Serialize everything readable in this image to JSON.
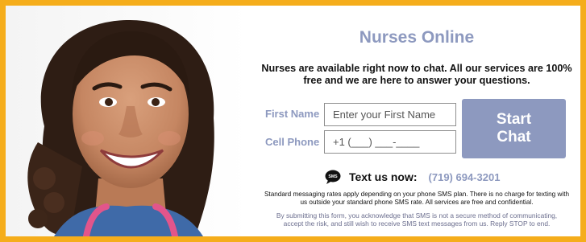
{
  "banner": {
    "title": "Nurses Online",
    "tagline_line1": "Nurses are available right now to chat. All our services are 100%",
    "tagline_line2": "free and we are here to answer your questions.",
    "photo_alt": "Smiling nurse portrait"
  },
  "form": {
    "first_name_label": "First Name",
    "first_name_placeholder": "Enter your First Name",
    "cell_phone_label": "Cell Phone",
    "cell_phone_placeholder": "+1 (___) ___-____",
    "start_button_line1": "Start",
    "start_button_line2": "Chat"
  },
  "sms": {
    "icon": "sms-bubble-icon",
    "icon_text": "SMS",
    "label": "Text us now:",
    "number": "(719) 694-3201"
  },
  "notices": {
    "disclaimer_line1": "Standard messaging rates apply depending on your phone SMS plan. There is no charge for texting with",
    "disclaimer_line2": "us outside your standard phone SMS rate. All services are free and confidential.",
    "consent_line1": "By submitting this form, you acknowledge that SMS is not a secure method of communicating,",
    "consent_line2": "accept the risk, and still wish to receive SMS text messages from us. Reply STOP to end."
  },
  "colors": {
    "border": "#f5ad1b",
    "accent": "#8d99bf",
    "text": "#111111"
  }
}
